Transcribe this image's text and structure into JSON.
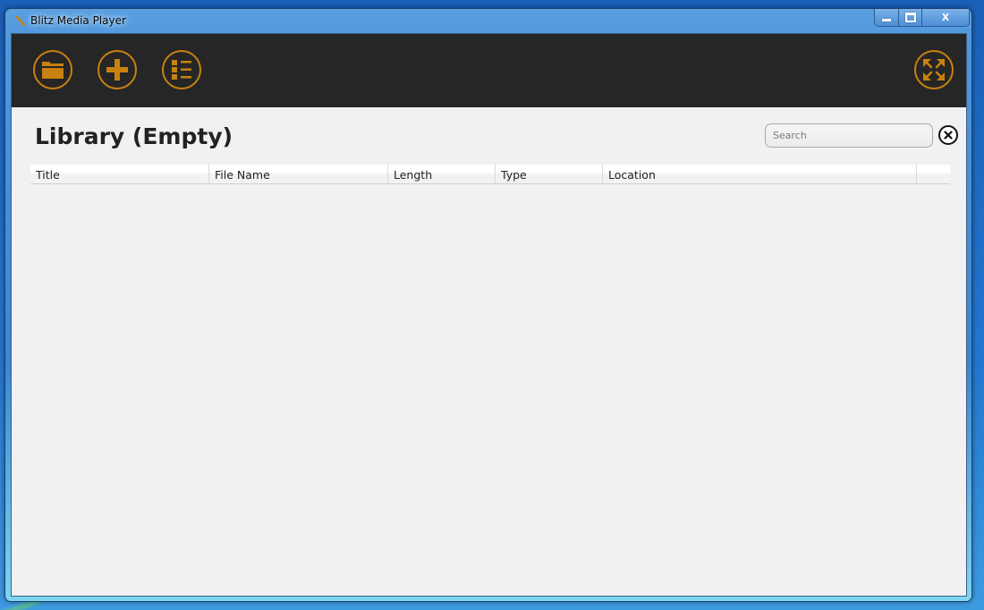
{
  "window": {
    "title": "Blitz Media Player",
    "controls": {
      "minimize": "minimize",
      "maximize": "maximize",
      "close": "X"
    }
  },
  "toolbar": {
    "accent_color": "#c8820f",
    "background_color": "#262626",
    "buttons": [
      {
        "id": "open-folder",
        "icon": "folder-icon"
      },
      {
        "id": "add",
        "icon": "plus-icon"
      },
      {
        "id": "playlist",
        "icon": "list-icon"
      },
      {
        "id": "fullscreen",
        "icon": "expand-arrows-icon"
      }
    ]
  },
  "library": {
    "title": "Library (Empty)",
    "search": {
      "placeholder": "Search",
      "value": ""
    },
    "clear_icon": "close-circle-icon",
    "columns": [
      "Title",
      "File Name",
      "Length",
      "Type",
      "Location"
    ],
    "rows": []
  }
}
